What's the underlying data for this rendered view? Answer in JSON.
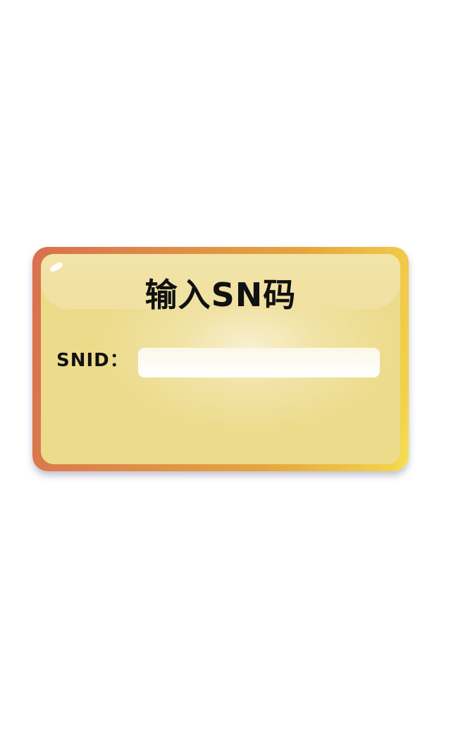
{
  "dialog": {
    "title": "输入SN码",
    "snid_label": "SNID：",
    "snid_value": "",
    "snid_placeholder": ""
  }
}
